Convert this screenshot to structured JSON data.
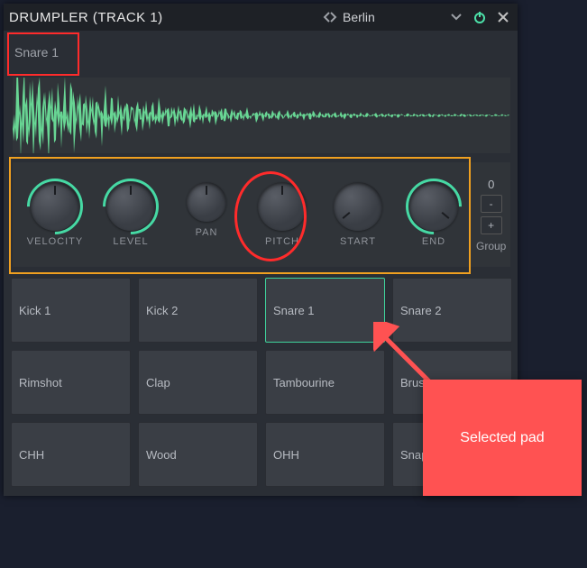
{
  "titlebar": {
    "title": "DRUMPLER (TRACK 1)",
    "preset": "Berlin"
  },
  "sample": {
    "name": "Snare 1"
  },
  "knobs": {
    "velocity": "VELOCITY",
    "level": "LEVEL",
    "pan": "PAN",
    "pitch": "PITCH",
    "start": "START",
    "end": "END"
  },
  "group": {
    "value": "0",
    "label": "Group",
    "minus": "-",
    "plus": "+"
  },
  "pads": [
    {
      "label": "Kick 1",
      "selected": false
    },
    {
      "label": "Kick 2",
      "selected": false
    },
    {
      "label": "Snare 1",
      "selected": true
    },
    {
      "label": "Snare 2",
      "selected": false
    },
    {
      "label": "Rimshot",
      "selected": false
    },
    {
      "label": "Clap",
      "selected": false
    },
    {
      "label": "Tambourine",
      "selected": false
    },
    {
      "label": "Brush",
      "selected": false
    },
    {
      "label": "CHH",
      "selected": false
    },
    {
      "label": "Wood",
      "selected": false
    },
    {
      "label": "OHH",
      "selected": false
    },
    {
      "label": "Snap",
      "selected": false
    }
  ],
  "callout": {
    "text": "Selected pad"
  },
  "colors": {
    "accent": "#46d9a4",
    "highlight_red": "#ff2b2b",
    "highlight_orange": "#f0a020",
    "callout": "#ff5252"
  }
}
